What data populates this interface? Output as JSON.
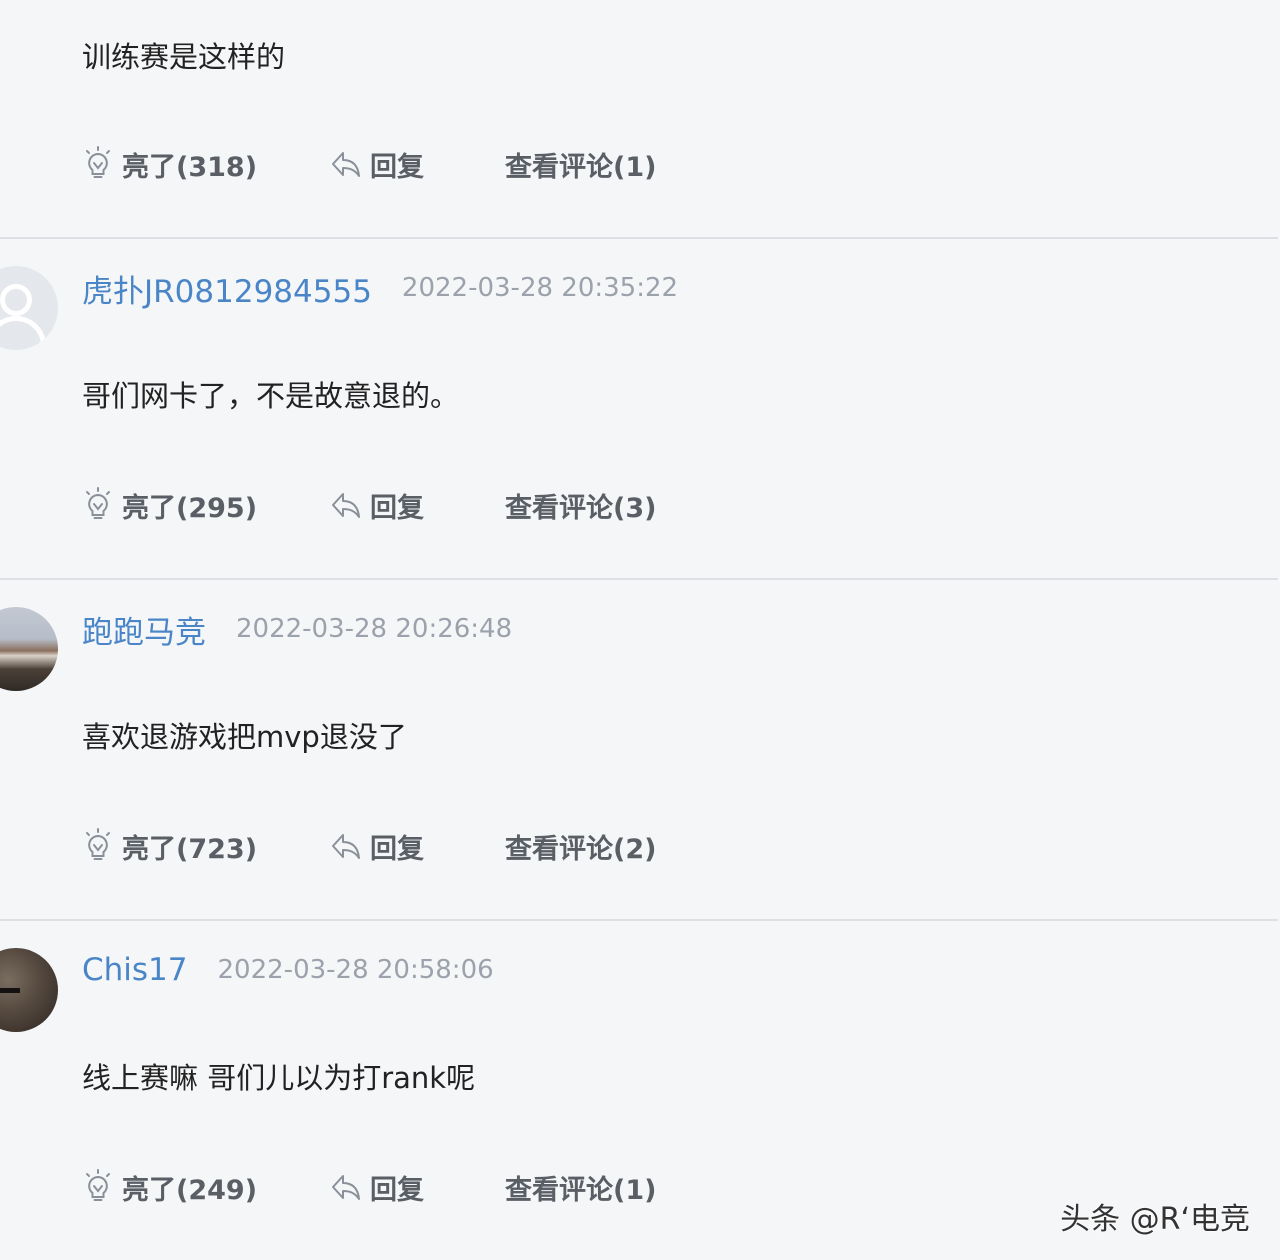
{
  "comments": [
    {
      "text": "训练赛是这样的",
      "actions": {
        "like": "亮了(318)",
        "reply": "回复",
        "view": "查看评论(1)"
      }
    },
    {
      "username": "虎扑JR0812984555",
      "timestamp": "2022-03-28 20:35:22",
      "text": "哥们网卡了，不是故意退的。",
      "actions": {
        "like": "亮了(295)",
        "reply": "回复",
        "view": "查看评论(3)"
      }
    },
    {
      "username": "跑跑马竞",
      "timestamp": "2022-03-28 20:26:48",
      "text": "喜欢退游戏把mvp退没了",
      "actions": {
        "like": "亮了(723)",
        "reply": "回复",
        "view": "查看评论(2)"
      }
    },
    {
      "username": "Chis17",
      "timestamp": "2022-03-28 20:58:06",
      "text": "线上赛嘛 哥们儿以为打rank呢",
      "actions": {
        "like": "亮了(249)",
        "reply": "回复",
        "view": "查看评论(1)"
      }
    }
  ],
  "watermark": "头条 @R‘电竞",
  "icons": {
    "like": "lightbulb-icon",
    "reply": "reply-arrow-icon"
  },
  "colors": {
    "username": "#4a86c7",
    "timestamp": "#9ca2ab",
    "action": "#5a5f66",
    "divider": "#dcdfe4",
    "background": "#f5f6f8"
  }
}
